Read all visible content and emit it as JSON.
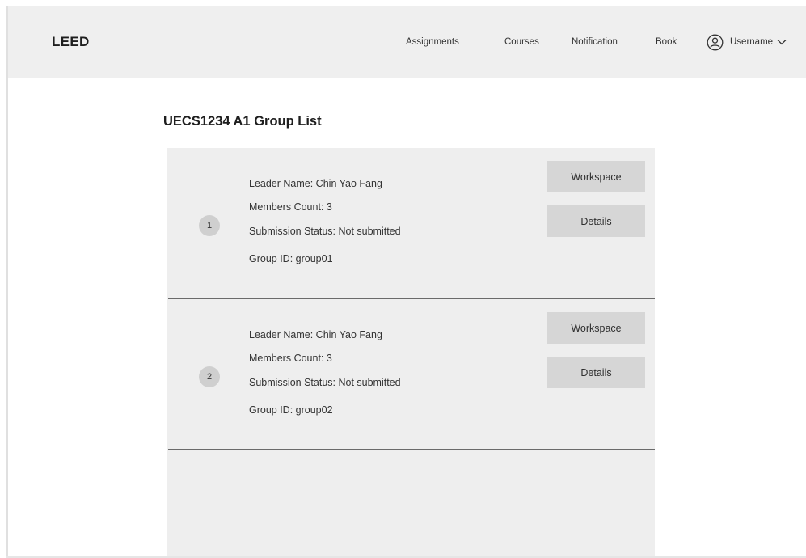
{
  "navbar": {
    "brand": "LEED",
    "links": [
      {
        "label": "Assignments"
      },
      {
        "label": "Courses"
      },
      {
        "label": "Notification"
      },
      {
        "label": "Book"
      }
    ],
    "username": "Username"
  },
  "page": {
    "title": "UECS1234 A1 Group List"
  },
  "groups": [
    {
      "number": "1",
      "leader_line": "Leader Name: Chin Yao Fang",
      "members_line": "Members Count: 3",
      "status_line": "Submission Status: Not submitted",
      "group_id_line": "Group ID: group01",
      "workspace_label": "Workspace",
      "details_label": "Details"
    },
    {
      "number": "2",
      "leader_line": "Leader Name: Chin Yao Fang",
      "members_line": "Members Count: 3",
      "status_line": "Submission Status: Not submitted",
      "group_id_line": "Group ID: group02",
      "workspace_label": "Workspace",
      "details_label": "Details"
    }
  ],
  "icons": {
    "user": "user-circle-icon",
    "dropdown": "chevron-down-icon"
  }
}
